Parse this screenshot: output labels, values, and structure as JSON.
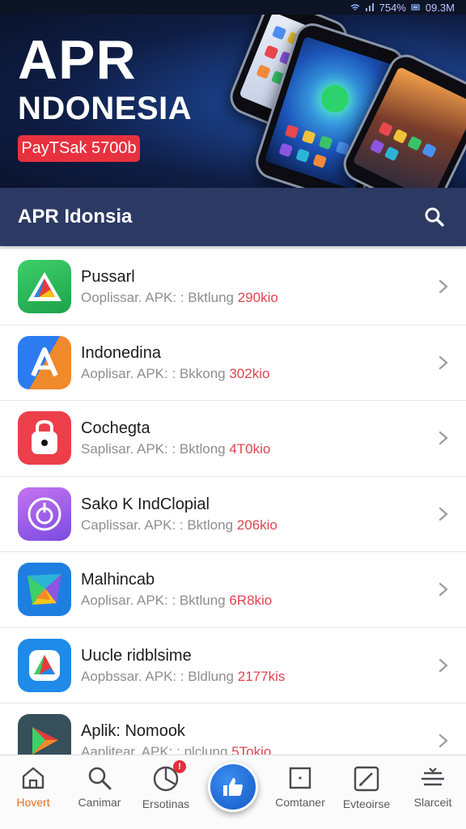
{
  "status_bar": {
    "battery": "754%",
    "time": "09.3M"
  },
  "hero": {
    "title": "APR",
    "subtitle": "NDONESIA",
    "badge": "PayTSak 5700b"
  },
  "header": {
    "title": "APR Idonsia"
  },
  "apps": [
    {
      "name": "Pussarl",
      "subtitle": "Ooplissar. APK: : Bktlung",
      "size": "290kio",
      "icon": "drive-triangle-icon"
    },
    {
      "name": "Indonedina",
      "subtitle": "Aoplisar. APK: : Bkkong",
      "size": "302kio",
      "icon": "a-letter-icon"
    },
    {
      "name": "Cochegta",
      "subtitle": "Saplisar. APK: : Bktlong",
      "size": "4T0kio",
      "icon": "lock-bag-icon"
    },
    {
      "name": "Sako K IndClopial",
      "subtitle": "Caplissar. APK: : Bktlong",
      "size": "206kio",
      "icon": "target-circle-icon"
    },
    {
      "name": "Malhincab",
      "subtitle": "Aoplisar. APK: : Bktlung",
      "size": "6R8kio",
      "icon": "colorful-fold-icon"
    },
    {
      "name": "Uucle ridblsime",
      "subtitle": "Aopbssar. APK: : Bldlung",
      "size": "2177kis",
      "icon": "drive-triangle-icon"
    },
    {
      "name": "Aplik: Nomook",
      "subtitle": "Aaplitear. APK: : plclung",
      "size": "5Tokio",
      "icon": "play-arrow-icon"
    }
  ],
  "nav": {
    "items": [
      {
        "label": "Hovert",
        "icon": "home-icon",
        "active": true
      },
      {
        "label": "Canimar",
        "icon": "search-icon",
        "active": false
      },
      {
        "label": "Ersotinas",
        "icon": "chart-icon",
        "active": false,
        "badge": "!"
      },
      {
        "label": "Comtaner",
        "icon": "square-icon",
        "active": false
      },
      {
        "label": "Evteoirse",
        "icon": "edit-icon",
        "active": false
      },
      {
        "label": "Slarceit",
        "icon": "layers-icon",
        "active": false
      }
    ]
  },
  "colors": {
    "header": "#2c3a63",
    "accent": "#e8313e",
    "active_nav": "#ee6a1f",
    "fab": "#1e6ad8"
  }
}
